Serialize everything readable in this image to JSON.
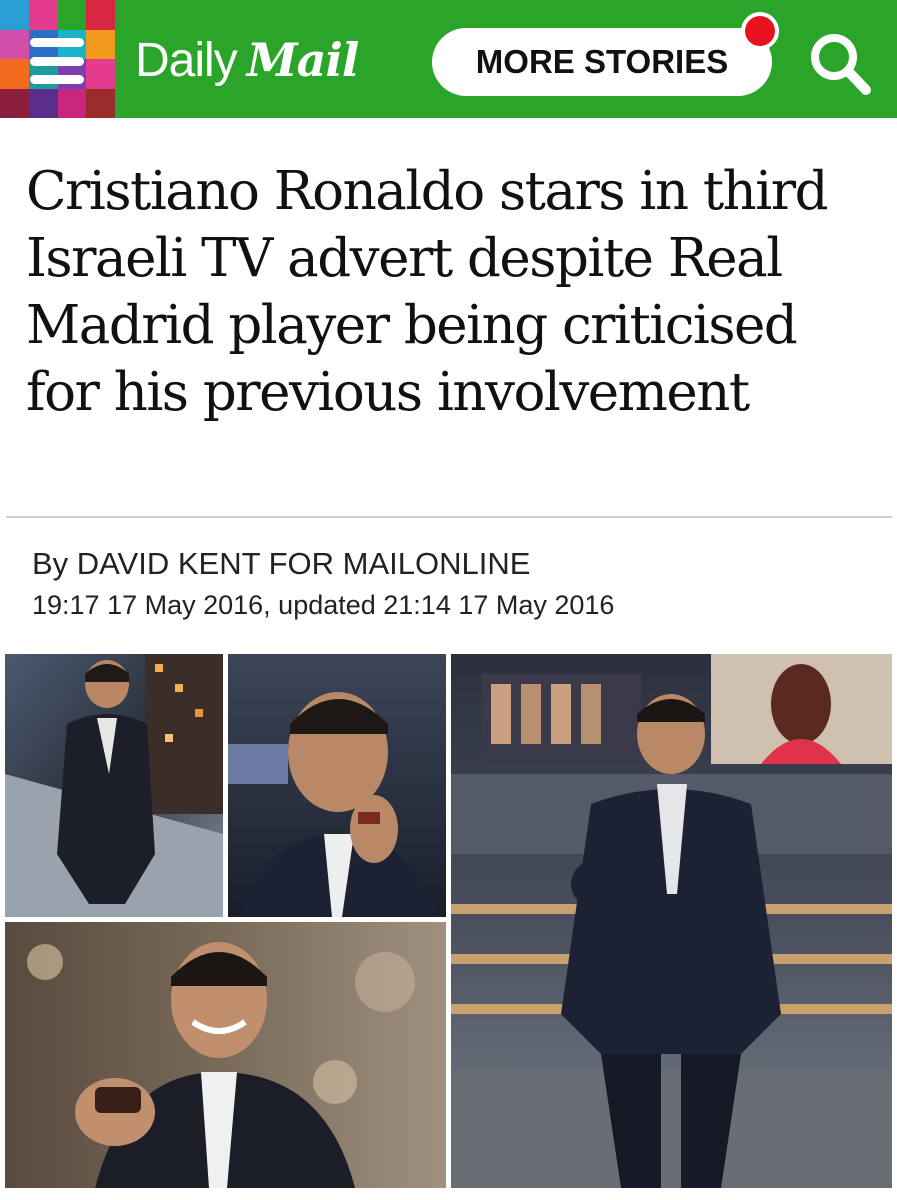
{
  "header": {
    "logo_daily": "Daily",
    "logo_mail": "Mail",
    "more_stories_label": "MORE STORIES",
    "colors": {
      "bar": "#2aa52a",
      "notification": "#e8121e"
    }
  },
  "article": {
    "headline": "Cristiano Ronaldo stars in third Israeli TV advert despite Real Madrid player being criticised for his previous involvement",
    "byline": "By DAVID KENT FOR MAILONLINE",
    "dateline": "19:17 17 May 2016, updated 21:14 17 May 2016"
  },
  "photos": {
    "photo_1": "ronaldo-on-rooftop-photo",
    "photo_2": "ronaldo-close-up-photo",
    "photo_3": "ronaldo-smiling-pointing-photo",
    "photo_4": "ronaldo-studio-full-length-photo"
  }
}
